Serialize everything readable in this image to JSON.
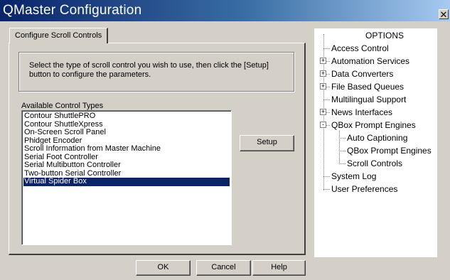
{
  "window": {
    "title": "QMaster Configuration",
    "close_glyph": "✕"
  },
  "tab": {
    "label": "Configure Scroll Controls"
  },
  "info": {
    "text": "Select the type of scroll control you wish to use, then click the [Setup] button to configure the parameters."
  },
  "list": {
    "label": "Available Control Types",
    "items": [
      "Contour ShuttlePRO",
      "Contour ShuttleXpress",
      "On-Screen Scroll Panel",
      "Phidget Encoder",
      "Scroll Information from Master Machine",
      "Serial Foot Controller",
      "Serial Multibutton Controller",
      "Two-button Serial Controller",
      "Virtual Spider Box"
    ],
    "selected": "Virtual Spider Box"
  },
  "buttons": {
    "setup": "Setup",
    "ok": "OK",
    "cancel": "Cancel",
    "help": "Help"
  },
  "options": {
    "header": "OPTIONS",
    "items": [
      {
        "label": "Access Control",
        "expandable": false
      },
      {
        "label": "Automation Services",
        "expandable": true,
        "state": "+"
      },
      {
        "label": "Data Converters",
        "expandable": true,
        "state": "+"
      },
      {
        "label": "File Based Queues",
        "expandable": true,
        "state": "+"
      },
      {
        "label": "Multilingual Support",
        "expandable": false
      },
      {
        "label": "News Interfaces",
        "expandable": true,
        "state": "+"
      },
      {
        "label": "QBox Prompt Engines",
        "expandable": true,
        "state": "-"
      },
      {
        "label": "Auto Captioning",
        "expandable": false,
        "child": true
      },
      {
        "label": "QBox Prompt Engines",
        "expandable": false,
        "child": true
      },
      {
        "label": "Scroll Controls",
        "expandable": false,
        "child": true
      },
      {
        "label": "System Log",
        "expandable": false
      },
      {
        "label": "User Preferences",
        "expandable": false
      }
    ]
  },
  "colors": {
    "titlebar_start": "#0a246a",
    "titlebar_end": "#a6caf0",
    "selection": "#0a246a",
    "face": "#d4d0c8"
  }
}
